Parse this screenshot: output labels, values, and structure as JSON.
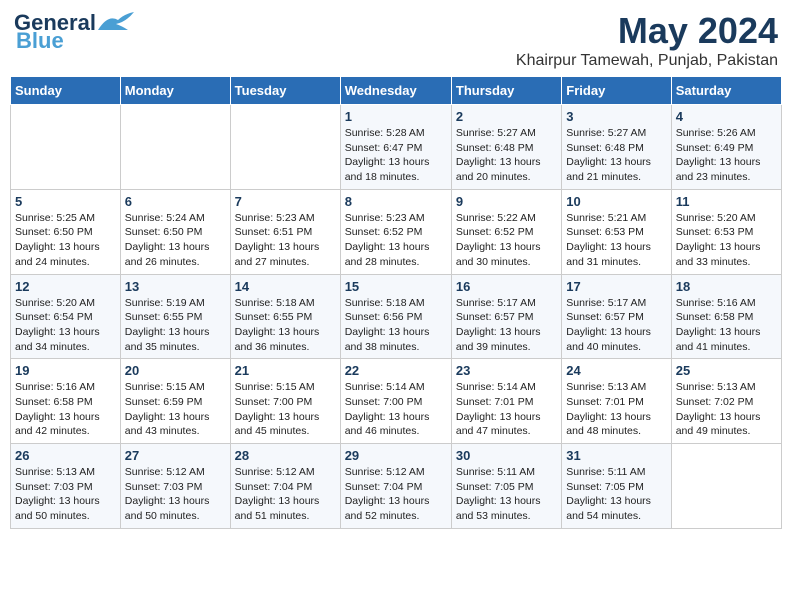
{
  "header": {
    "logo_line1": "General",
    "logo_line2": "Blue",
    "month": "May 2024",
    "location": "Khairpur Tamewah, Punjab, Pakistan"
  },
  "weekdays": [
    "Sunday",
    "Monday",
    "Tuesday",
    "Wednesday",
    "Thursday",
    "Friday",
    "Saturday"
  ],
  "weeks": [
    [
      {
        "day": "",
        "info": ""
      },
      {
        "day": "",
        "info": ""
      },
      {
        "day": "",
        "info": ""
      },
      {
        "day": "1",
        "info": "Sunrise: 5:28 AM\nSunset: 6:47 PM\nDaylight: 13 hours\nand 18 minutes."
      },
      {
        "day": "2",
        "info": "Sunrise: 5:27 AM\nSunset: 6:48 PM\nDaylight: 13 hours\nand 20 minutes."
      },
      {
        "day": "3",
        "info": "Sunrise: 5:27 AM\nSunset: 6:48 PM\nDaylight: 13 hours\nand 21 minutes."
      },
      {
        "day": "4",
        "info": "Sunrise: 5:26 AM\nSunset: 6:49 PM\nDaylight: 13 hours\nand 23 minutes."
      }
    ],
    [
      {
        "day": "5",
        "info": "Sunrise: 5:25 AM\nSunset: 6:50 PM\nDaylight: 13 hours\nand 24 minutes."
      },
      {
        "day": "6",
        "info": "Sunrise: 5:24 AM\nSunset: 6:50 PM\nDaylight: 13 hours\nand 26 minutes."
      },
      {
        "day": "7",
        "info": "Sunrise: 5:23 AM\nSunset: 6:51 PM\nDaylight: 13 hours\nand 27 minutes."
      },
      {
        "day": "8",
        "info": "Sunrise: 5:23 AM\nSunset: 6:52 PM\nDaylight: 13 hours\nand 28 minutes."
      },
      {
        "day": "9",
        "info": "Sunrise: 5:22 AM\nSunset: 6:52 PM\nDaylight: 13 hours\nand 30 minutes."
      },
      {
        "day": "10",
        "info": "Sunrise: 5:21 AM\nSunset: 6:53 PM\nDaylight: 13 hours\nand 31 minutes."
      },
      {
        "day": "11",
        "info": "Sunrise: 5:20 AM\nSunset: 6:53 PM\nDaylight: 13 hours\nand 33 minutes."
      }
    ],
    [
      {
        "day": "12",
        "info": "Sunrise: 5:20 AM\nSunset: 6:54 PM\nDaylight: 13 hours\nand 34 minutes."
      },
      {
        "day": "13",
        "info": "Sunrise: 5:19 AM\nSunset: 6:55 PM\nDaylight: 13 hours\nand 35 minutes."
      },
      {
        "day": "14",
        "info": "Sunrise: 5:18 AM\nSunset: 6:55 PM\nDaylight: 13 hours\nand 36 minutes."
      },
      {
        "day": "15",
        "info": "Sunrise: 5:18 AM\nSunset: 6:56 PM\nDaylight: 13 hours\nand 38 minutes."
      },
      {
        "day": "16",
        "info": "Sunrise: 5:17 AM\nSunset: 6:57 PM\nDaylight: 13 hours\nand 39 minutes."
      },
      {
        "day": "17",
        "info": "Sunrise: 5:17 AM\nSunset: 6:57 PM\nDaylight: 13 hours\nand 40 minutes."
      },
      {
        "day": "18",
        "info": "Sunrise: 5:16 AM\nSunset: 6:58 PM\nDaylight: 13 hours\nand 41 minutes."
      }
    ],
    [
      {
        "day": "19",
        "info": "Sunrise: 5:16 AM\nSunset: 6:58 PM\nDaylight: 13 hours\nand 42 minutes."
      },
      {
        "day": "20",
        "info": "Sunrise: 5:15 AM\nSunset: 6:59 PM\nDaylight: 13 hours\nand 43 minutes."
      },
      {
        "day": "21",
        "info": "Sunrise: 5:15 AM\nSunset: 7:00 PM\nDaylight: 13 hours\nand 45 minutes."
      },
      {
        "day": "22",
        "info": "Sunrise: 5:14 AM\nSunset: 7:00 PM\nDaylight: 13 hours\nand 46 minutes."
      },
      {
        "day": "23",
        "info": "Sunrise: 5:14 AM\nSunset: 7:01 PM\nDaylight: 13 hours\nand 47 minutes."
      },
      {
        "day": "24",
        "info": "Sunrise: 5:13 AM\nSunset: 7:01 PM\nDaylight: 13 hours\nand 48 minutes."
      },
      {
        "day": "25",
        "info": "Sunrise: 5:13 AM\nSunset: 7:02 PM\nDaylight: 13 hours\nand 49 minutes."
      }
    ],
    [
      {
        "day": "26",
        "info": "Sunrise: 5:13 AM\nSunset: 7:03 PM\nDaylight: 13 hours\nand 50 minutes."
      },
      {
        "day": "27",
        "info": "Sunrise: 5:12 AM\nSunset: 7:03 PM\nDaylight: 13 hours\nand 50 minutes."
      },
      {
        "day": "28",
        "info": "Sunrise: 5:12 AM\nSunset: 7:04 PM\nDaylight: 13 hours\nand 51 minutes."
      },
      {
        "day": "29",
        "info": "Sunrise: 5:12 AM\nSunset: 7:04 PM\nDaylight: 13 hours\nand 52 minutes."
      },
      {
        "day": "30",
        "info": "Sunrise: 5:11 AM\nSunset: 7:05 PM\nDaylight: 13 hours\nand 53 minutes."
      },
      {
        "day": "31",
        "info": "Sunrise: 5:11 AM\nSunset: 7:05 PM\nDaylight: 13 hours\nand 54 minutes."
      },
      {
        "day": "",
        "info": ""
      }
    ]
  ]
}
